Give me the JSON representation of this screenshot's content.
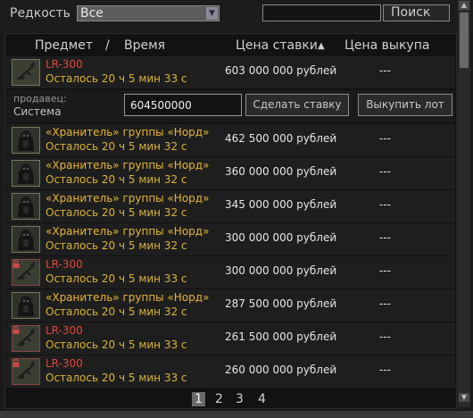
{
  "filter": {
    "rarity_label": "Редкость",
    "rarity_value": "Все",
    "search_value": "",
    "search_button": "Поиск"
  },
  "columns": {
    "item": "Предмет",
    "slash": "/",
    "time": "Время",
    "bid": "Цена ставки",
    "sort_indicator": "▲",
    "buyout": "Цена выкупа"
  },
  "expanded": {
    "seller_label": "продавец:",
    "seller_name": "Система",
    "bid_value": "604500000",
    "make_bid_button": "Сделать ставку",
    "buyout_button": "Выкупить лот"
  },
  "rows": [
    {
      "name": "LR-300",
      "time": "Осталось 20 ч 5 мин 33 с",
      "bid": "603 000 000 рублей",
      "buyout": "---",
      "color": "#e0473b",
      "icon": "rifle-icon",
      "locked": false
    },
    {
      "name": "«Хранитель» группы «Норд»",
      "time": "Осталось 20 ч 5 мин 32 с",
      "bid": "462 500 000 рублей",
      "buyout": "---",
      "color": "#e8b63a",
      "icon": "armor-icon",
      "locked": false
    },
    {
      "name": "«Хранитель» группы «Норд»",
      "time": "Осталось 20 ч 5 мин 32 с",
      "bid": "360 000 000 рублей",
      "buyout": "---",
      "color": "#e8b63a",
      "icon": "armor-icon",
      "locked": false
    },
    {
      "name": "«Хранитель» группы «Норд»",
      "time": "Осталось 20 ч 5 мин 32 с",
      "bid": "345 000 000 рублей",
      "buyout": "---",
      "color": "#e8b63a",
      "icon": "armor-icon",
      "locked": false
    },
    {
      "name": "«Хранитель» группы «Норд»",
      "time": "Осталось 20 ч 5 мин 32 с",
      "bid": "300 000 000 рублей",
      "buyout": "---",
      "color": "#e8b63a",
      "icon": "armor-icon",
      "locked": false
    },
    {
      "name": "LR-300",
      "time": "Осталось 20 ч 5 мин 33 с",
      "bid": "300 000 000 рублей",
      "buyout": "---",
      "color": "#e0473b",
      "icon": "rifle-icon",
      "locked": true
    },
    {
      "name": "«Хранитель» группы «Норд»",
      "time": "Осталось 20 ч 5 мин 32 с",
      "bid": "287 500 000 рублей",
      "buyout": "---",
      "color": "#e8b63a",
      "icon": "armor-icon",
      "locked": false
    },
    {
      "name": "LR-300",
      "time": "Осталось 20 ч 5 мин 33 с",
      "bid": "261 500 000 рублей",
      "buyout": "---",
      "color": "#e0473b",
      "icon": "rifle-icon",
      "locked": true
    },
    {
      "name": "LR-300",
      "time": "Осталось 20 ч 5 мин 33 с",
      "bid": "260 000 000 рублей",
      "buyout": "---",
      "color": "#e0473b",
      "icon": "rifle-icon",
      "locked": true
    }
  ],
  "pagination": {
    "pages": [
      "1",
      "2",
      "3",
      "4"
    ],
    "current": "1"
  }
}
